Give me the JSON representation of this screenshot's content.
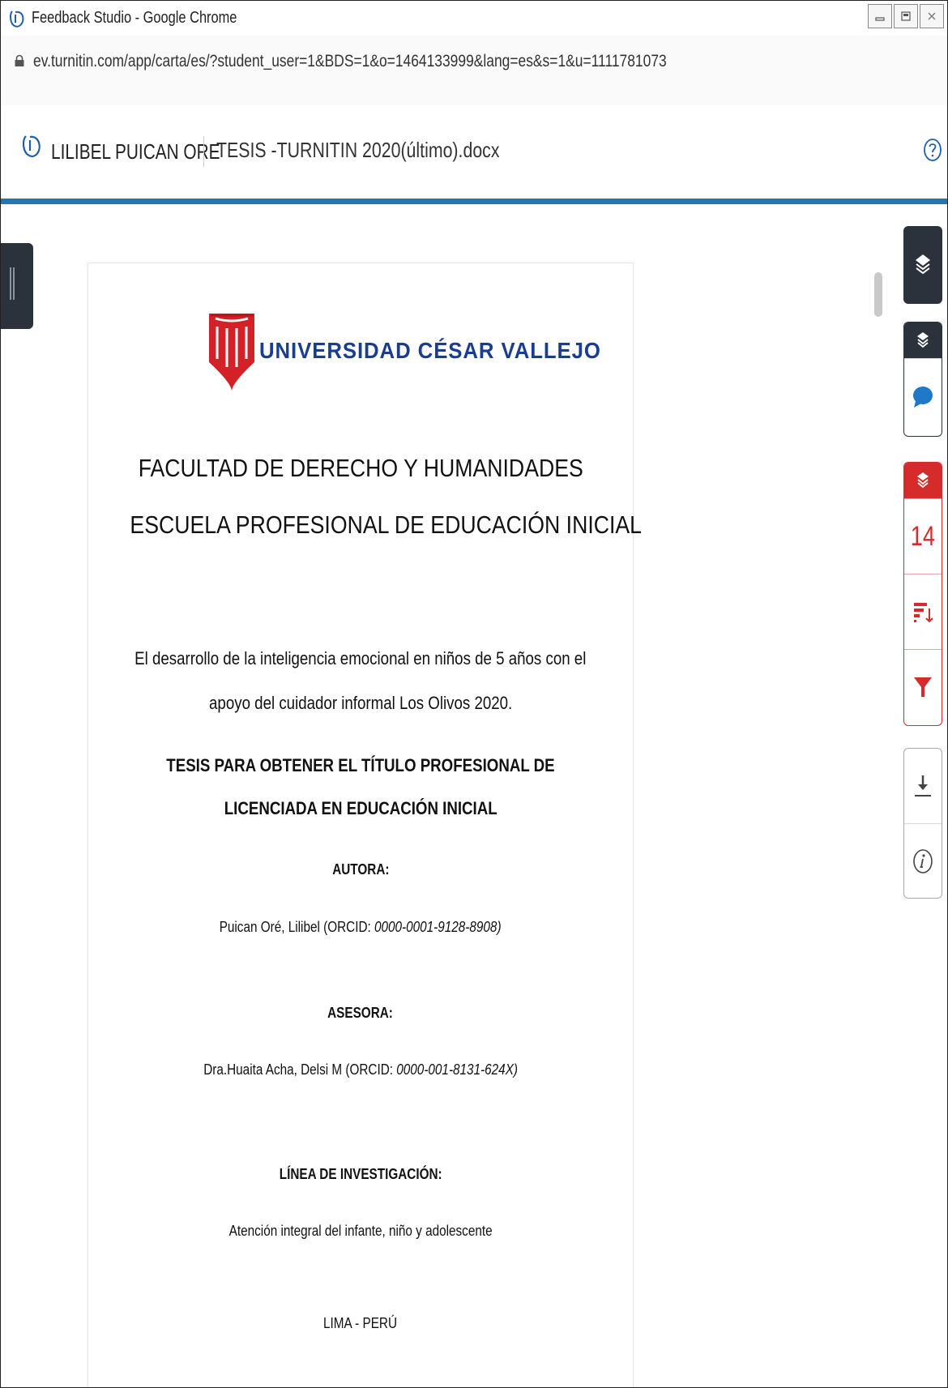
{
  "window": {
    "title": "Feedback Studio - Google Chrome",
    "controls": [
      "minimize-icon",
      "restore-icon",
      "close-icon"
    ]
  },
  "browser": {
    "url": "ev.turnitin.com/app/carta/es/?student_user=1&BDS=1&o=1464133999&lang=es&s=1&u=1111781073"
  },
  "header": {
    "student_name": "LILIBEL PUICAN ORE",
    "document_name": "TESIS -TURNITIN 2020(último).docx"
  },
  "document": {
    "university": "UNIVERSIDAD CÉSAR VALLEJO",
    "faculty": "FACULTAD DE DERECHO Y HUMANIDADES",
    "school": "ESCUELA PROFESIONAL DE EDUCACIÓN INICIAL",
    "topic_line1": "El desarrollo de la inteligencia emocional en niños de 5 años con el",
    "topic_line2": "apoyo del cuidador informal Los Olivos 2020.",
    "thesis_line1": "TESIS PARA OBTENER EL TÍTULO PROFESIONAL DE",
    "thesis_line2": "LICENCIADA EN EDUCACIÓN INICIAL",
    "author_heading": "AUTORA:",
    "author_name": "Puican Oré, Lilibel (ORCID: ",
    "author_orcid": "0000-0001-9128-8908)",
    "advisor_heading": "ASESORA:",
    "advisor_name": "Dra.Huaita Acha, Delsi M (ORCID: ",
    "advisor_orcid": "0000-001-8131-624X)",
    "research_heading": "LÍNEA DE INVESTIGACIÓN:",
    "research_line": "Atención integral del infante, niño y adolescente",
    "place": "LIMA - PERÚ"
  },
  "toolbar": {
    "similarity_score": "14"
  },
  "colors": {
    "accent_blue": "#1f78b4",
    "similarity_red": "#d62b2b",
    "dark_panel": "#2b323c",
    "university_blue": "#1a3d8f"
  }
}
